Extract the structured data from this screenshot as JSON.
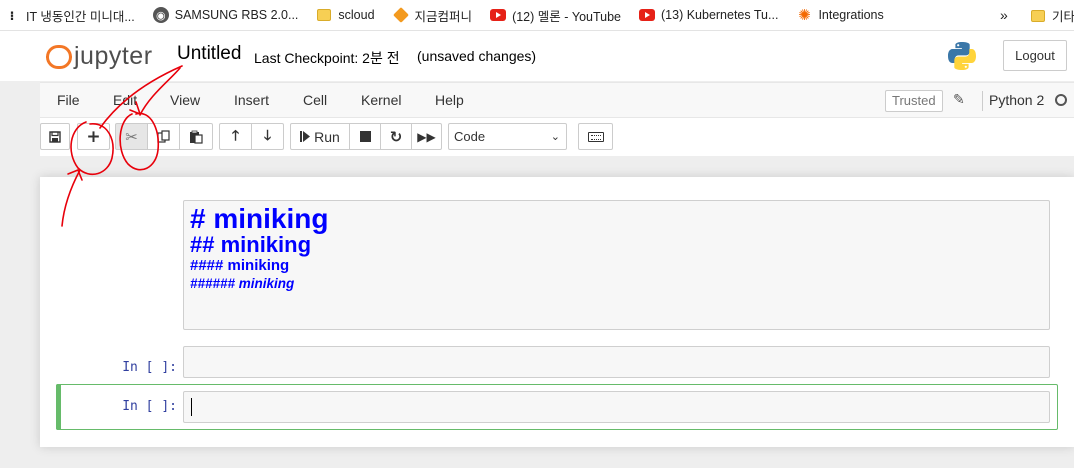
{
  "bookmarks": {
    "items": [
      {
        "label": "IT 냉동인간 미니대...",
        "icon": "apps-icon"
      },
      {
        "label": "SAMSUNG RBS 2.0...",
        "icon": "globe-icon"
      },
      {
        "label": "scloud",
        "icon": "folder-icon"
      },
      {
        "label": "지금컴퍼니",
        "icon": "box-icon"
      },
      {
        "label": "(12) 멜론 - YouTube",
        "icon": "youtube-icon"
      },
      {
        "label": "(13) Kubernetes Tu...",
        "icon": "youtube-icon"
      },
      {
        "label": "Integrations",
        "icon": "grafana-icon"
      }
    ],
    "more": "»",
    "other_label": "기타"
  },
  "header": {
    "logo_text": "jupyter",
    "notebook_title": "Untitled",
    "checkpoint": "Last Checkpoint: 2분 전",
    "unsaved": "(unsaved changes)",
    "logout_label": "Logout"
  },
  "menubar": {
    "items": [
      "File",
      "Edit",
      "View",
      "Insert",
      "Cell",
      "Kernel",
      "Help"
    ],
    "trusted": "Trusted",
    "kernel": "Python 2"
  },
  "toolbar": {
    "run_label": "Run",
    "cell_type": "Code"
  },
  "cells": {
    "markdown": {
      "h1": "# miniking",
      "h2": "## miniking",
      "h4": "#### miniking",
      "h6": "###### miniking"
    },
    "code": [
      {
        "prompt": "In [ ]:"
      },
      {
        "prompt": "In [ ]:"
      }
    ]
  },
  "colors": {
    "annotation": "#e8000b",
    "selected_border": "#66bb6a",
    "logo_orange": "#f37726",
    "markdown_text": "#0000ff"
  }
}
